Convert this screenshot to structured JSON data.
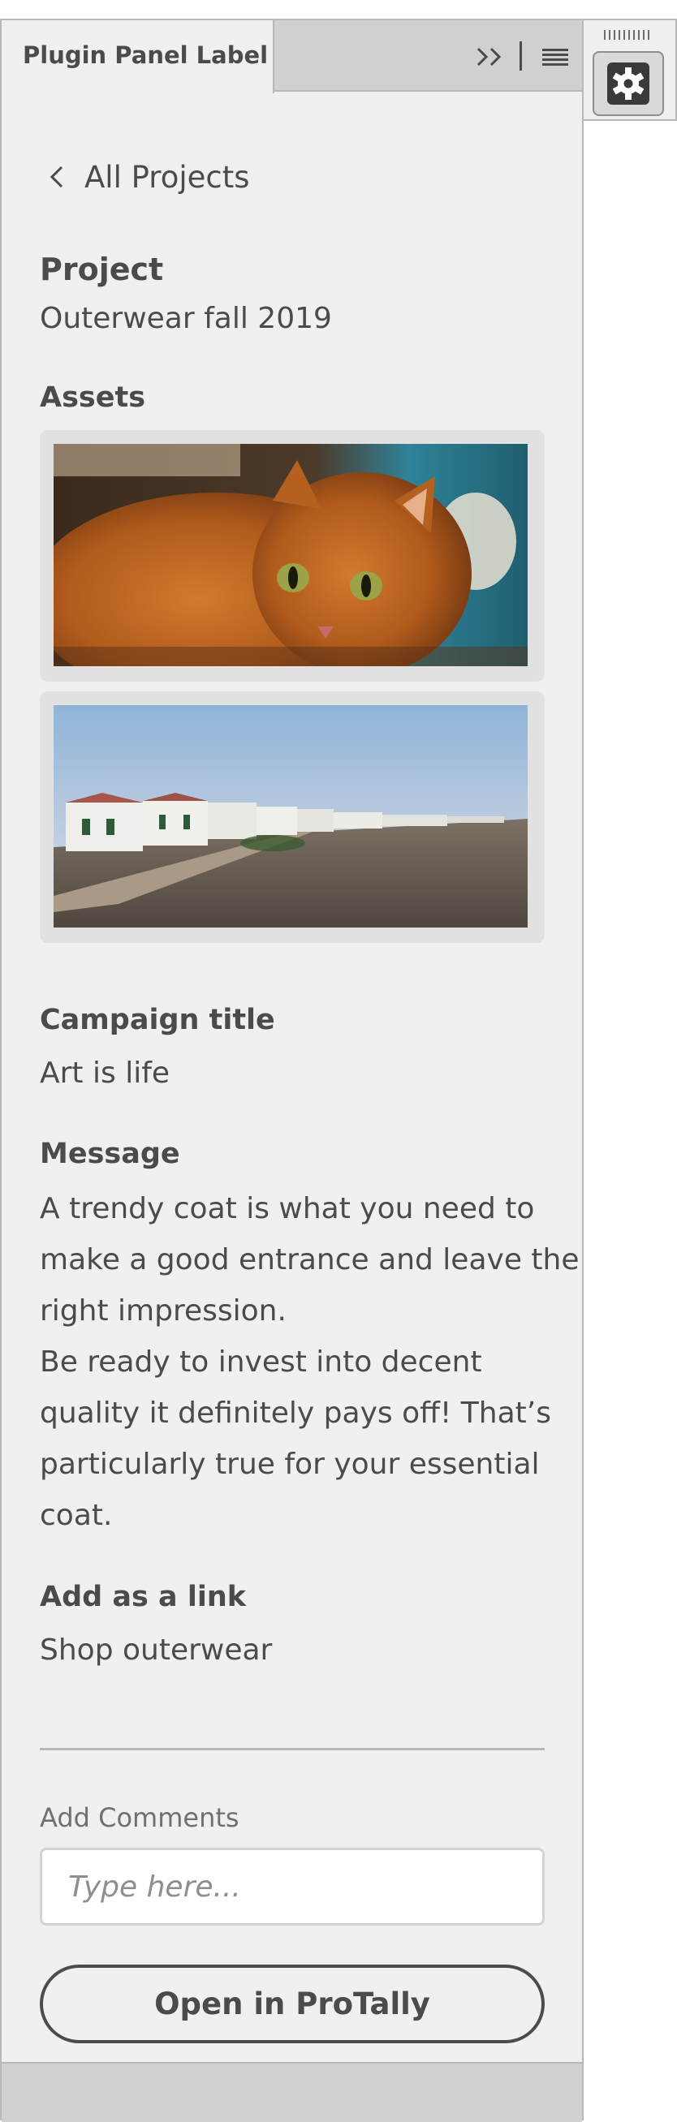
{
  "panel": {
    "tab_label": "Plugin Panel Label",
    "icons": {
      "collapse": "double-chevron-right-icon",
      "menu": "hamburger-menu-icon"
    }
  },
  "nav": {
    "back_label": "All Projects",
    "back_icon": "chevron-left-icon"
  },
  "project": {
    "heading": "Project",
    "name": "Outerwear fall 2019"
  },
  "assets": {
    "heading": "Assets",
    "items": [
      {
        "subject": "orange tabby cat photo"
      },
      {
        "subject": "white seaside houses photo"
      }
    ]
  },
  "campaign": {
    "heading": "Campaign title",
    "value": "Art is life"
  },
  "message": {
    "heading": "Message",
    "lines": [
      "A trendy coat is what you need to",
      "make a good entrance and leave the",
      "right impression.",
      "Be ready to invest into decent",
      "quality it definitely pays off! That’s",
      "particularly true for your essential",
      "coat."
    ]
  },
  "link": {
    "heading": "Add as a link",
    "value": "Shop outerwear"
  },
  "comments": {
    "label": "Add Comments",
    "placeholder": "Type here...",
    "value": ""
  },
  "actions": {
    "open_label": "Open in ProTally"
  },
  "dock": {
    "settings_icon": "gear-icon",
    "grip_icon": "grip-handle-icon"
  },
  "colors": {
    "panel_bg": "#f0f0f0",
    "chrome_bg": "#d0d0d0",
    "border": "#b8b8b8",
    "text": "#4b4b4b",
    "muted_text": "#707070",
    "asset_frame": "#e1e1e1"
  }
}
